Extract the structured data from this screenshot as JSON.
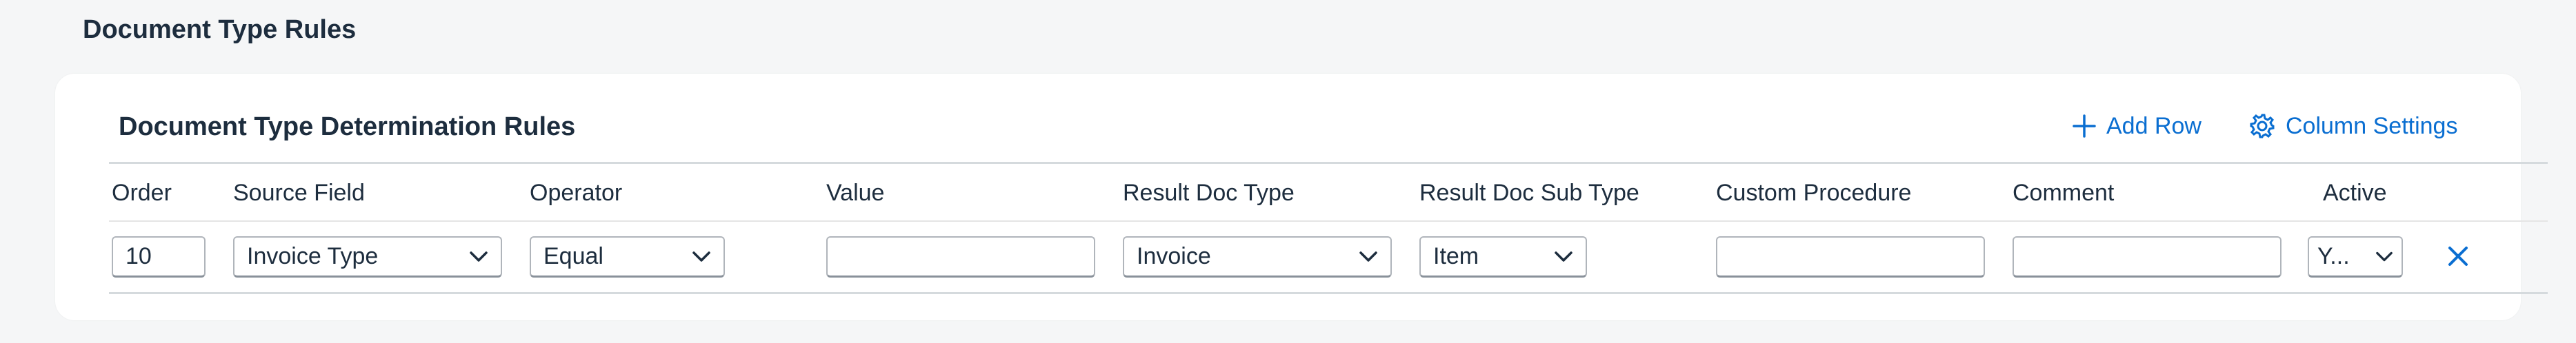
{
  "page": {
    "title": "Document Type Rules"
  },
  "card": {
    "title": "Document Type Determination Rules",
    "toolbar": {
      "add_row_label": "Add Row",
      "column_settings_label": "Column Settings"
    }
  },
  "table": {
    "columns": [
      "Order",
      "Source Field",
      "Operator",
      "Value",
      "Result Doc Type",
      "Result Doc Sub Type",
      "Custom Procedure",
      "Comment",
      "Active"
    ],
    "rows": [
      {
        "order": "10",
        "source_field": "Invoice Type",
        "operator": "Equal",
        "value": "",
        "result_doc_type": "Invoice",
        "result_doc_sub_type": "Item",
        "custom_procedure": "",
        "comment": "",
        "active": "Y..."
      }
    ]
  },
  "colors": {
    "accent": "#0a6ed1",
    "text": "#1d2d3e",
    "background": "#f5f6f7"
  },
  "icons": {
    "add": "plus-icon",
    "settings": "gear-icon",
    "dropdown": "chevron-down-icon",
    "delete": "close-icon"
  }
}
